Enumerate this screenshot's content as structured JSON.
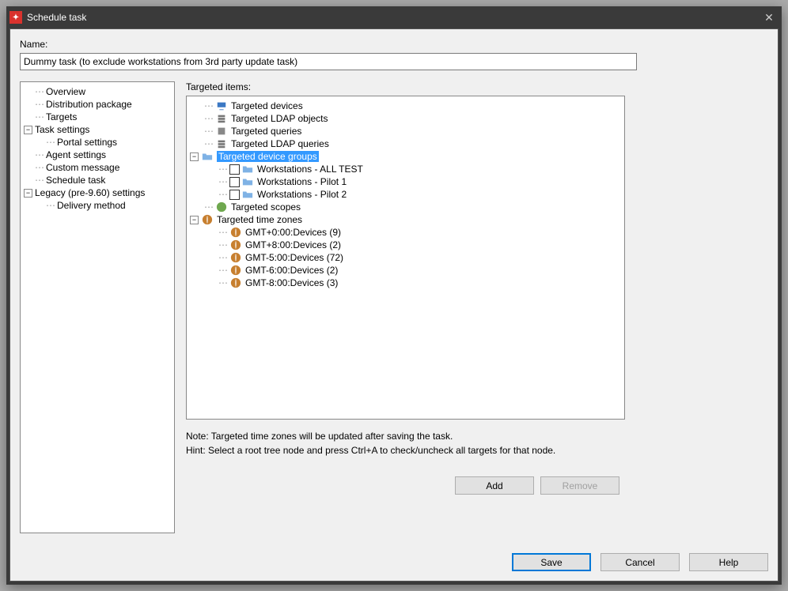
{
  "window": {
    "title": "Schedule task"
  },
  "name": {
    "label": "Name:",
    "value": "Dummy task (to exclude workstations from 3rd party update task)"
  },
  "nav": {
    "items": [
      {
        "label": "Overview",
        "indent": 1,
        "toggle": ""
      },
      {
        "label": "Distribution package",
        "indent": 1,
        "toggle": ""
      },
      {
        "label": "Targets",
        "indent": 1,
        "toggle": ""
      },
      {
        "label": "Task settings",
        "indent": 0,
        "toggle": "-"
      },
      {
        "label": "Portal settings",
        "indent": 2,
        "toggle": ""
      },
      {
        "label": "Agent settings",
        "indent": 1,
        "toggle": ""
      },
      {
        "label": "Custom message",
        "indent": 1,
        "toggle": ""
      },
      {
        "label": "Schedule task",
        "indent": 1,
        "toggle": ""
      },
      {
        "label": "Legacy (pre-9.60) settings",
        "indent": 0,
        "toggle": "-"
      },
      {
        "label": "Delivery method",
        "indent": 2,
        "toggle": ""
      }
    ]
  },
  "targets": {
    "label": "Targeted items:",
    "tree": [
      {
        "label": "Targeted devices",
        "indent": 1,
        "icon": "monitor",
        "toggle": ""
      },
      {
        "label": "Targeted LDAP objects",
        "indent": 1,
        "icon": "ldap",
        "toggle": ""
      },
      {
        "label": "Targeted queries",
        "indent": 1,
        "icon": "query",
        "toggle": ""
      },
      {
        "label": "Targeted LDAP queries",
        "indent": 1,
        "icon": "ldapq",
        "toggle": ""
      },
      {
        "label": "Targeted device groups",
        "indent": 0,
        "icon": "folder",
        "toggle": "-",
        "selected": true
      },
      {
        "label": "Workstations - ALL TEST",
        "indent": 2,
        "icon": "folder",
        "toggle": "",
        "check": true
      },
      {
        "label": "Workstations - Pilot 1",
        "indent": 2,
        "icon": "folder",
        "toggle": "",
        "check": true
      },
      {
        "label": "Workstations - Pilot 2",
        "indent": 2,
        "icon": "folder",
        "toggle": "",
        "check": true
      },
      {
        "label": "Targeted scopes",
        "indent": 1,
        "icon": "scope",
        "toggle": ""
      },
      {
        "label": "Targeted time zones",
        "indent": 0,
        "icon": "globe",
        "toggle": "-"
      },
      {
        "label": "GMT+0:00:Devices (9)",
        "indent": 2,
        "icon": "globe",
        "toggle": ""
      },
      {
        "label": "GMT+8:00:Devices (2)",
        "indent": 2,
        "icon": "globe",
        "toggle": ""
      },
      {
        "label": "GMT-5:00:Devices (72)",
        "indent": 2,
        "icon": "globe",
        "toggle": ""
      },
      {
        "label": "GMT-6:00:Devices (2)",
        "indent": 2,
        "icon": "globe",
        "toggle": ""
      },
      {
        "label": "GMT-8:00:Devices (3)",
        "indent": 2,
        "icon": "globe",
        "toggle": ""
      }
    ],
    "note": "Note: Targeted time zones will be updated after saving the task.",
    "hint": "Hint: Select a root tree node and press Ctrl+A to check/uncheck all targets for that node."
  },
  "buttons": {
    "add": "Add",
    "remove": "Remove",
    "save": "Save",
    "cancel": "Cancel",
    "help": "Help"
  }
}
